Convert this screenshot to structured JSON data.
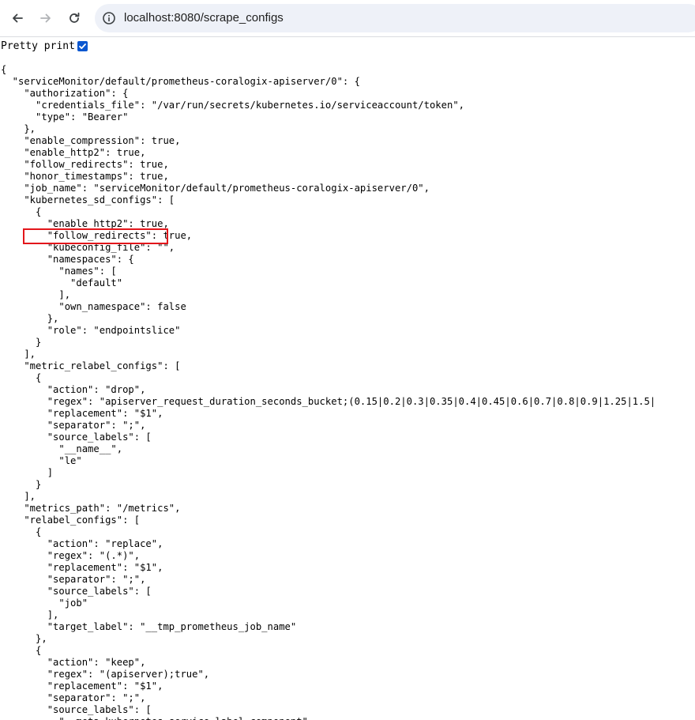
{
  "browser": {
    "url": "localhost:8080/scrape_configs",
    "back_icon": "arrow-left-icon",
    "forward_icon": "arrow-right-icon",
    "reload_icon": "reload-icon",
    "site_info_icon": "info-icon"
  },
  "pretty_print": {
    "label": "Pretty print",
    "checked": true
  },
  "highlight": {
    "target": "\"kubernetes_sd_configs\"",
    "color": "#e3161b"
  },
  "json_lines": [
    "{",
    "  \"serviceMonitor/default/prometheus-coralogix-apiserver/0\": {",
    "    \"authorization\": {",
    "      \"credentials_file\": \"/var/run/secrets/kubernetes.io/serviceaccount/token\",",
    "      \"type\": \"Bearer\"",
    "    },",
    "    \"enable_compression\": true,",
    "    \"enable_http2\": true,",
    "    \"follow_redirects\": true,",
    "    \"honor_timestamps\": true,",
    "    \"job_name\": \"serviceMonitor/default/prometheus-coralogix-apiserver/0\",",
    "    \"kubernetes_sd_configs\": [",
    "      {",
    "        \"enable_http2\": true,",
    "        \"follow_redirects\": true,",
    "        \"kubeconfig_file\": \"\",",
    "        \"namespaces\": {",
    "          \"names\": [",
    "            \"default\"",
    "          ],",
    "          \"own_namespace\": false",
    "        },",
    "        \"role\": \"endpointslice\"",
    "      }",
    "    ],",
    "    \"metric_relabel_configs\": [",
    "      {",
    "        \"action\": \"drop\",",
    "        \"regex\": \"apiserver_request_duration_seconds_bucket;(0.15|0.2|0.3|0.35|0.4|0.45|0.6|0.7|0.8|0.9|1.25|1.5|",
    "        \"replacement\": \"$1\",",
    "        \"separator\": \";\",",
    "        \"source_labels\": [",
    "          \"__name__\",",
    "          \"le\"",
    "        ]",
    "      }",
    "    ],",
    "    \"metrics_path\": \"/metrics\",",
    "    \"relabel_configs\": [",
    "      {",
    "        \"action\": \"replace\",",
    "        \"regex\": \"(.*)\",",
    "        \"replacement\": \"$1\",",
    "        \"separator\": \";\",",
    "        \"source_labels\": [",
    "          \"job\"",
    "        ],",
    "        \"target_label\": \"__tmp_prometheus_job_name\"",
    "      },",
    "      {",
    "        \"action\": \"keep\",",
    "        \"regex\": \"(apiserver);true\",",
    "        \"replacement\": \"$1\",",
    "        \"separator\": \";\",",
    "        \"source_labels\": [",
    "          \"__meta_kubernetes_service_label_component\","
  ]
}
